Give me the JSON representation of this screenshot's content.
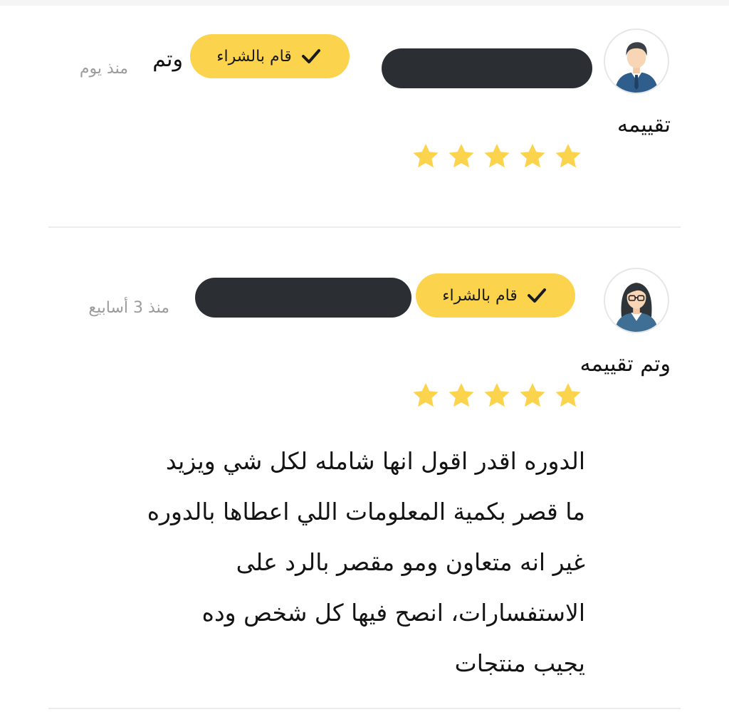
{
  "colors": {
    "badge": "#fbd34d",
    "star": "#fbd34d",
    "redaction": "#2b2f33",
    "muted_text": "#9b9b9b",
    "divider": "#ececec"
  },
  "reviews": [
    {
      "avatar": "male-user-icon",
      "badge_label": "قام بالشراء",
      "badge_icon": "checkmark-icon",
      "rated_prefix": "وتم",
      "rated_suffix": "تقييمه",
      "time": "منذ يوم",
      "rating": 5
    },
    {
      "avatar": "female-user-icon",
      "badge_label": "قام بالشراء",
      "badge_icon": "checkmark-icon",
      "rated_text": "وتم تقييمه",
      "time": "منذ 3 أسابيع",
      "rating": 5,
      "body_lines": [
        "الدوره اقدر اقول انها شامله لكل شي ويزيد",
        "ما قصر بكمية المعلومات اللي اعطاها بالدوره",
        "غير انه متعاون ومو مقصر بالرد على",
        "الاستفسارات، انصح فيها كل شخص وده",
        "يجيب منتجات"
      ]
    }
  ]
}
